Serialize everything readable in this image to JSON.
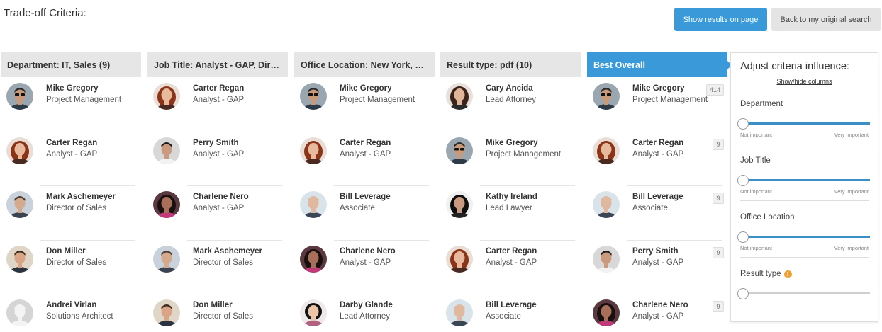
{
  "page": {
    "title": "Trade-off Criteria:"
  },
  "buttons": {
    "show_results": "Show results on page",
    "back": "Back to my original search"
  },
  "columns": [
    {
      "header": "Department: IT, Sales (9)",
      "people": [
        {
          "name": "Mike Gregory",
          "role": "Project Management",
          "avatar": "man-sunglasses"
        },
        {
          "name": "Carter Regan",
          "role": "Analyst - GAP",
          "avatar": "woman-red-hair"
        },
        {
          "name": "Mark Aschemeyer",
          "role": "Director of Sales",
          "avatar": "man-grey-suit"
        },
        {
          "name": "Don Miller",
          "role": "Director of Sales",
          "avatar": "man-smiling"
        },
        {
          "name": "Andrei Virlan",
          "role": "Solutions Architect",
          "avatar": "placeholder"
        }
      ]
    },
    {
      "header": "Job Title: Analyst - GAP, Director of Sales",
      "people": [
        {
          "name": "Carter Regan",
          "role": "Analyst - GAP",
          "avatar": "woman-red-hair"
        },
        {
          "name": "Perry Smith",
          "role": "Analyst - GAP",
          "avatar": "man-young"
        },
        {
          "name": "Charlene Nero",
          "role": "Analyst - GAP",
          "avatar": "woman-dark-hair"
        },
        {
          "name": "Mark Aschemeyer",
          "role": "Director of Sales",
          "avatar": "man-grey-suit"
        },
        {
          "name": "Don Miller",
          "role": "Director of Sales",
          "avatar": "man-smiling"
        }
      ]
    },
    {
      "header": "Office Location: New York, Boston",
      "people": [
        {
          "name": "Mike Gregory",
          "role": "Project Management",
          "avatar": "man-sunglasses"
        },
        {
          "name": "Carter Regan",
          "role": "Analyst - GAP",
          "avatar": "woman-red-hair"
        },
        {
          "name": "Bill Leverage",
          "role": "Associate",
          "avatar": "man-bald"
        },
        {
          "name": "Charlene Nero",
          "role": "Analyst - GAP",
          "avatar": "woman-dark-hair"
        },
        {
          "name": "Darby Glande",
          "role": "Lead Attorney",
          "avatar": "woman-black-hair"
        }
      ]
    },
    {
      "header": "Result type: pdf (10)",
      "people": [
        {
          "name": "Cary Ancida",
          "role": "Lead Attorney",
          "avatar": "woman-brunette"
        },
        {
          "name": "Mike Gregory",
          "role": "Project Management",
          "avatar": "man-sunglasses"
        },
        {
          "name": "Kathy Ireland",
          "role": "Lead Lawyer",
          "avatar": "woman-dark-long"
        },
        {
          "name": "Carter Regan",
          "role": "Analyst - GAP",
          "avatar": "woman-red-hair"
        },
        {
          "name": "Bill Leverage",
          "role": "Associate",
          "avatar": "man-bald"
        }
      ]
    },
    {
      "header": "Best Overall",
      "best": true,
      "people": [
        {
          "name": "Mike Gregory",
          "role": "Project Management",
          "avatar": "man-sunglasses",
          "score": "414"
        },
        {
          "name": "Carter Regan",
          "role": "Analyst - GAP",
          "avatar": "woman-red-hair",
          "score": "9"
        },
        {
          "name": "Bill Leverage",
          "role": "Associate",
          "avatar": "man-bald",
          "score": "9"
        },
        {
          "name": "Perry Smith",
          "role": "Analyst - GAP",
          "avatar": "man-young",
          "score": "9"
        },
        {
          "name": "Charlene Nero",
          "role": "Analyst - GAP",
          "avatar": "woman-dark-hair",
          "score": "9"
        }
      ]
    }
  ],
  "panel": {
    "title": "Adjust criteria influence:",
    "link": "Show/hide columns",
    "criteria": [
      {
        "label": "Department",
        "min_label": "Not important",
        "max_label": "Very important",
        "level": 0,
        "active": true
      },
      {
        "label": "Job Title",
        "min_label": "Not important",
        "max_label": "Very important",
        "level": 0,
        "active": true
      },
      {
        "label": "Office Location",
        "min_label": "Not important",
        "max_label": "Very important",
        "level": 0,
        "active": true
      },
      {
        "label": "Result type",
        "level": 0,
        "active": false,
        "info_icon": "info-icon"
      }
    ]
  },
  "colors": {
    "accent": "#3a9ad9",
    "header_grey": "#e6e6e6",
    "warning": "#f0a030"
  }
}
